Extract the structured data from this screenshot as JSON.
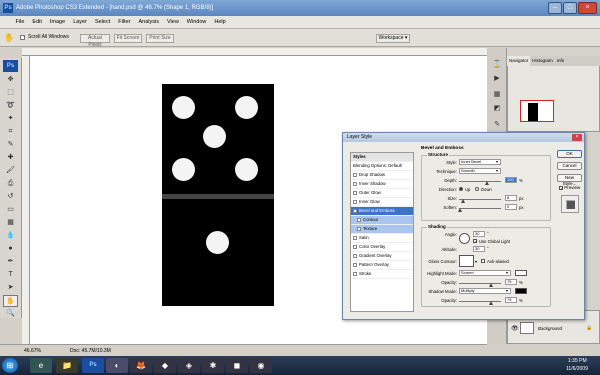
{
  "app": {
    "title": "Adobe Photoshop CS3 Extended - [hand.psd @ 46.7% (Shape 1, RGB/8)]"
  },
  "menu": [
    "File",
    "Edit",
    "Image",
    "Layer",
    "Select",
    "Filter",
    "Analysis",
    "View",
    "Window",
    "Help"
  ],
  "options": {
    "scroll_all": "Scroll All Windows",
    "actual_pixels": "Actual Pixels",
    "fit_screen": "Fit Screen",
    "print_size": "Print Size",
    "workspace": "Workspace ▾"
  },
  "navigator": {
    "tabs": [
      "Navigator",
      "Histogram",
      "Info"
    ]
  },
  "layers": {
    "layer_name": "Background"
  },
  "status": {
    "zoom": "46.67%",
    "doc": "Doc: 45.7M/10.3M"
  },
  "taskbar": {
    "time": "1:35 PM",
    "date": "11/6/2009"
  },
  "dialog": {
    "title": "Layer Style",
    "styles_header": "Styles",
    "blending": "Blending Options: Default",
    "items": [
      "Drop Shadow",
      "Inner Shadow",
      "Outer Glow",
      "Inner Glow",
      "Bevel and Emboss",
      "Contour",
      "Texture",
      "Satin",
      "Color Overlay",
      "Gradient Overlay",
      "Pattern Overlay",
      "Stroke"
    ],
    "ok": "OK",
    "cancel": "Cancel",
    "new_style": "New Style...",
    "preview": "Preview",
    "bevel_title": "Bevel and Emboss",
    "structure_title": "Structure",
    "style_label": "Style:",
    "style_value": "Inner Bevel",
    "technique_label": "Technique:",
    "technique_value": "Smooth",
    "depth_label": "Depth:",
    "depth_value": "100",
    "direction_label": "Direction:",
    "dir_up": "Up",
    "dir_down": "Down",
    "size_label": "Size:",
    "size_value": "8",
    "soften_label": "Soften:",
    "soften_value": "0",
    "shading_title": "Shading",
    "angle_label": "Angle:",
    "angle_value": "30",
    "global_light": "Use Global Light",
    "altitude_label": "Altitude:",
    "altitude_value": "30",
    "gloss_label": "Gloss Contour:",
    "antialiased": "Anti-aliased",
    "highlight_label": "Highlight Mode:",
    "highlight_value": "Screen",
    "opacity_label": "Opacity:",
    "highlight_opacity": "75",
    "shadow_label": "Shadow Mode:",
    "shadow_value": "Multiply",
    "shadow_opacity": "75",
    "pct": "%",
    "px": "px",
    "deg": "°",
    "degrees": "Degrees"
  }
}
